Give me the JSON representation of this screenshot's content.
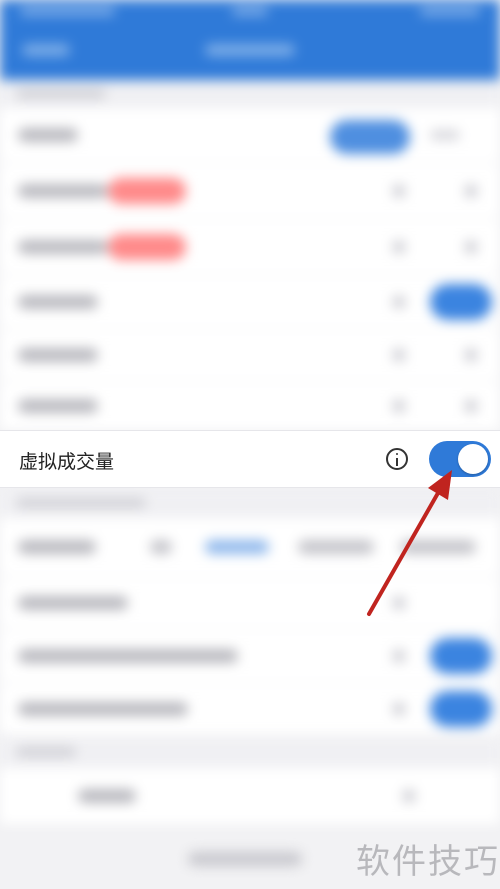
{
  "focused_row": {
    "label": "虚拟成交量",
    "toggle_on": true
  },
  "watermark": "软件技巧",
  "colors": {
    "header": "#2f7ad8",
    "toggle_on": "#2f7ad8",
    "arrow": "#c0241f"
  },
  "icons": [
    "info-icon",
    "red-arrow-annotation"
  ]
}
